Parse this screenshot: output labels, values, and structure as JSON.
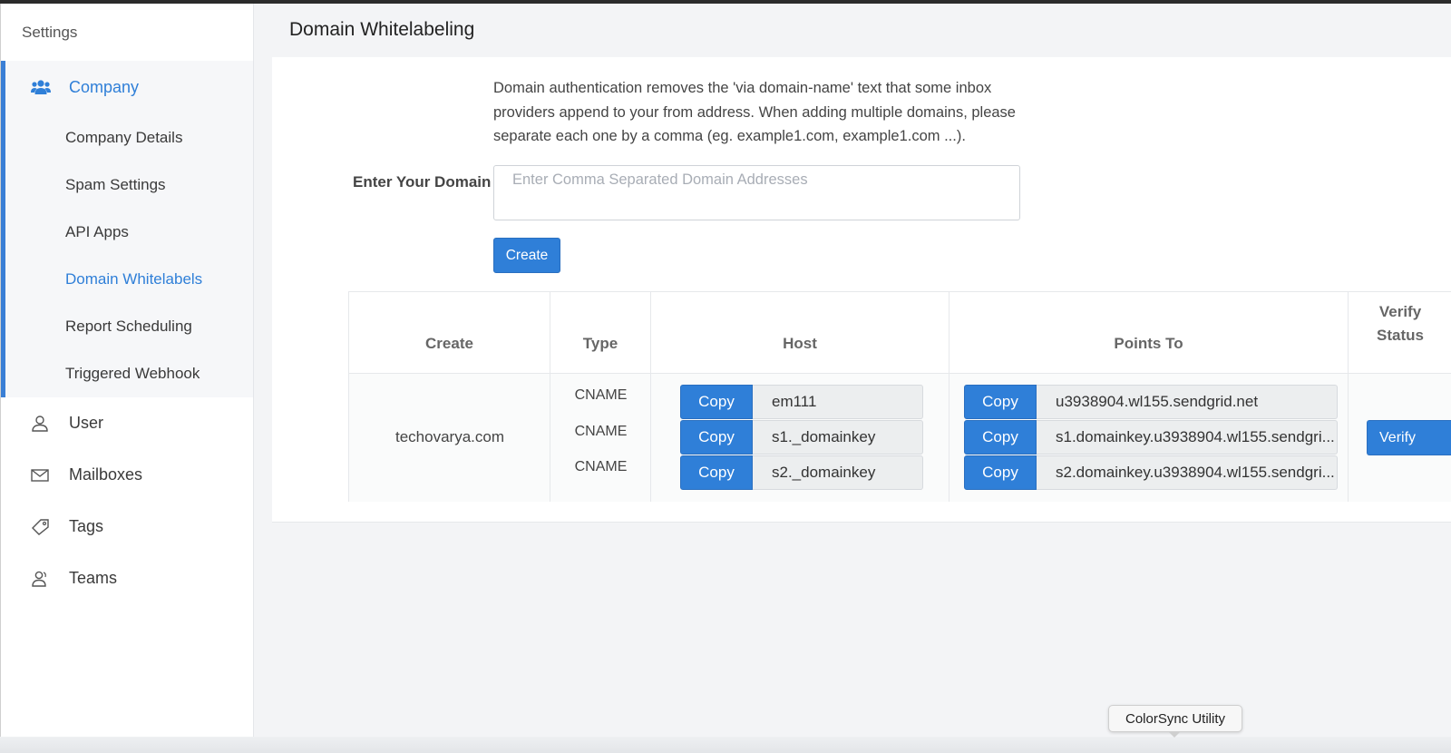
{
  "sidebar": {
    "title": "Settings",
    "company": {
      "label": "Company",
      "icon": "users-icon",
      "items": [
        {
          "label": "Company Details"
        },
        {
          "label": "Spam Settings"
        },
        {
          "label": "API Apps"
        },
        {
          "label": "Domain Whitelabels",
          "active": true
        },
        {
          "label": "Report Scheduling"
        },
        {
          "label": "Triggered Webhook"
        }
      ]
    },
    "nav": [
      {
        "label": "User",
        "icon": "user-icon"
      },
      {
        "label": "Mailboxes",
        "icon": "envelope-icon"
      },
      {
        "label": "Tags",
        "icon": "tag-icon"
      },
      {
        "label": "Teams",
        "icon": "team-icon"
      }
    ]
  },
  "page": {
    "title": "Domain Whitelabeling",
    "description": "Domain authentication removes the 'via domain-name' text that some inbox providers append to your from address. When adding multiple domains, please separate each one by a comma (eg. example1.com, example1.com ...).",
    "domain_label": "Enter Your Domain",
    "domain_placeholder": "Enter Comma Separated Domain Addresses",
    "domain_value": "",
    "create_label": "Create"
  },
  "table": {
    "headers": {
      "create": "Create",
      "type": "Type",
      "host": "Host",
      "points_to": "Points To",
      "verify_status_line1": "Verify",
      "verify_status_line2": "Status"
    },
    "row": {
      "domain": "techovarya.com",
      "verify_label": "Verify",
      "records": [
        {
          "type": "CNAME",
          "host": "em111",
          "points_to": "u3938904.wl155.sendgrid.net"
        },
        {
          "type": "CNAME",
          "host": "s1._domainkey",
          "points_to": "s1.domainkey.u3938904.wl155.sendgri..."
        },
        {
          "type": "CNAME",
          "host": "s2._domainkey",
          "points_to": "s2.domainkey.u3938904.wl155.sendgri..."
        }
      ],
      "copy_label": "Copy"
    }
  },
  "tooltip": {
    "text": "ColorSync Utility"
  },
  "colors": {
    "accent": "#2f7fd8",
    "sidebar_active_bg": "#f6f7f9",
    "main_bg": "#f3f4f6"
  }
}
